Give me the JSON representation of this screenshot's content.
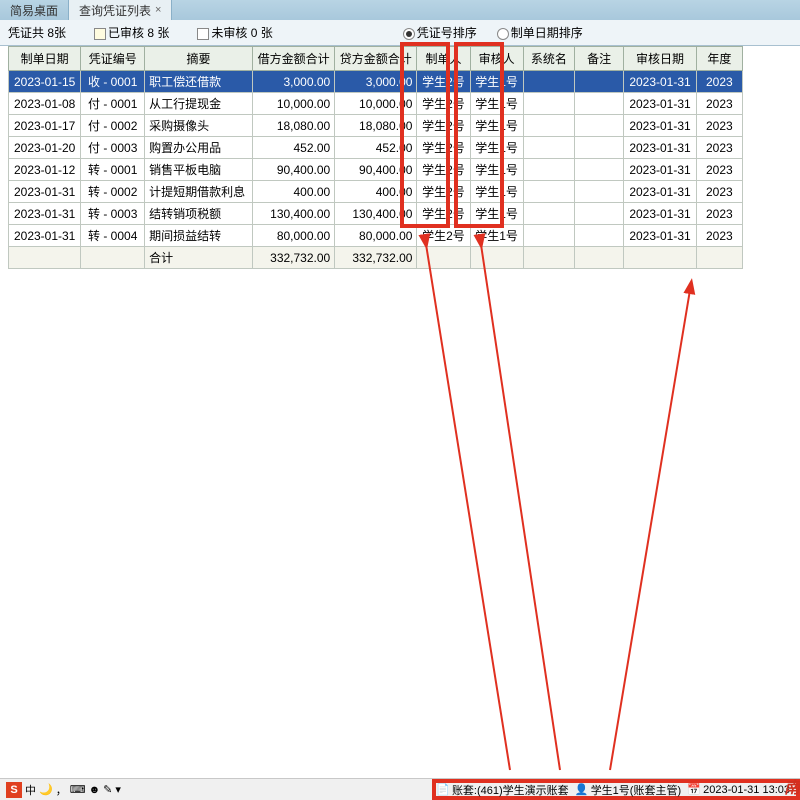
{
  "tabs": {
    "t1": "简易桌面",
    "t2": "查询凭证列表"
  },
  "top": {
    "count_label": "凭证共 8张",
    "checked_label": "已审核 8 张",
    "unchecked_label": "未审核 0 张",
    "sort_num": "凭证号排序",
    "sort_date": "制单日期排序"
  },
  "headers": [
    "制单日期",
    "凭证编号",
    "摘要",
    "借方金额合计",
    "贷方金额合计",
    "制单人",
    "审核人",
    "系统名",
    "备注",
    "审核日期",
    "年度"
  ],
  "rows": [
    {
      "date": "2023-01-15",
      "no": "收 - 0001",
      "sum": "职工偿还借款",
      "dr": "3,000.00",
      "cr": "3,000.00",
      "maker": "学生2号",
      "auditor": "学生1号",
      "sys": "",
      "memo": "",
      "adate": "2023-01-31",
      "year": "2023"
    },
    {
      "date": "2023-01-08",
      "no": "付 - 0001",
      "sum": "从工行提现金",
      "dr": "10,000.00",
      "cr": "10,000.00",
      "maker": "学生2号",
      "auditor": "学生1号",
      "sys": "",
      "memo": "",
      "adate": "2023-01-31",
      "year": "2023"
    },
    {
      "date": "2023-01-17",
      "no": "付 - 0002",
      "sum": "采购摄像头",
      "dr": "18,080.00",
      "cr": "18,080.00",
      "maker": "学生2号",
      "auditor": "学生1号",
      "sys": "",
      "memo": "",
      "adate": "2023-01-31",
      "year": "2023"
    },
    {
      "date": "2023-01-20",
      "no": "付 - 0003",
      "sum": "购置办公用品",
      "dr": "452.00",
      "cr": "452.00",
      "maker": "学生2号",
      "auditor": "学生1号",
      "sys": "",
      "memo": "",
      "adate": "2023-01-31",
      "year": "2023"
    },
    {
      "date": "2023-01-12",
      "no": "转 - 0001",
      "sum": "销售平板电脑",
      "dr": "90,400.00",
      "cr": "90,400.00",
      "maker": "学生2号",
      "auditor": "学生1号",
      "sys": "",
      "memo": "",
      "adate": "2023-01-31",
      "year": "2023"
    },
    {
      "date": "2023-01-31",
      "no": "转 - 0002",
      "sum": "计提短期借款利息",
      "dr": "400.00",
      "cr": "400.00",
      "maker": "学生2号",
      "auditor": "学生1号",
      "sys": "",
      "memo": "",
      "adate": "2023-01-31",
      "year": "2023"
    },
    {
      "date": "2023-01-31",
      "no": "转 - 0003",
      "sum": "结转销项税额",
      "dr": "130,400.00",
      "cr": "130,400.00",
      "maker": "学生2号",
      "auditor": "学生1号",
      "sys": "",
      "memo": "",
      "adate": "2023-01-31",
      "year": "2023"
    },
    {
      "date": "2023-01-31",
      "no": "转 - 0004",
      "sum": "期间损益结转",
      "dr": "80,000.00",
      "cr": "80,000.00",
      "maker": "学生2号",
      "auditor": "学生1号",
      "sys": "",
      "memo": "",
      "adate": "2023-01-31",
      "year": "2023"
    }
  ],
  "total": {
    "sum": "合计",
    "dr": "332,732.00",
    "cr": "332,732.00"
  },
  "status": {
    "ime": "中",
    "account": "账套:(461)学生演示账套",
    "user": "学生1号(账套主管)",
    "datetime": "2023-01-31 13:03"
  },
  "watermark": "南"
}
